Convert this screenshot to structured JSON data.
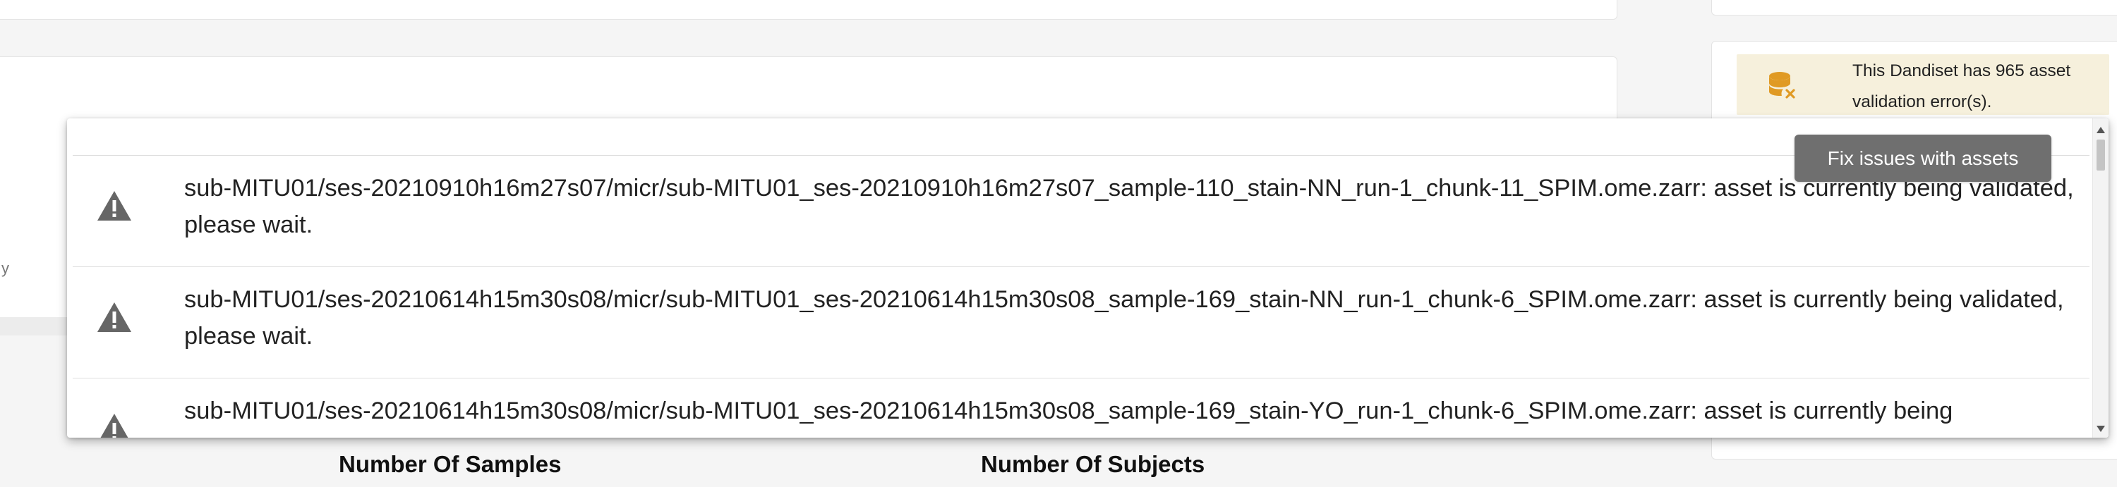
{
  "background": {
    "left_snippet": "y",
    "stats": {
      "samples_label": "Number Of Samples",
      "subjects_label": "Number Of Subjects"
    }
  },
  "validation_alert": {
    "text": "This Dandiset has 965 asset validation error(s).",
    "icon": "database-error-icon",
    "icon_color": "#e09a24",
    "background_color": "#f6f0dc"
  },
  "tooltip": {
    "label": "Fix issues with assets"
  },
  "error_list": {
    "icon": "warning-icon",
    "items": [
      {
        "message": "sub-MITU01/ses-20210910h16m27s07/micr/sub-MITU01_ses-20210910h16m27s07_sample-110_stain-NN_run-1_chunk-11_SPIM.ome.zarr: asset is currently being validated, please wait."
      },
      {
        "message": "sub-MITU01/ses-20210614h15m30s08/micr/sub-MITU01_ses-20210614h15m30s08_sample-169_stain-NN_run-1_chunk-6_SPIM.ome.zarr: asset is currently being validated, please wait."
      },
      {
        "message": "sub-MITU01/ses-20210614h15m30s08/micr/sub-MITU01_ses-20210614h15m30s08_sample-169_stain-YO_run-1_chunk-6_SPIM.ome.zarr: asset is currently being"
      }
    ]
  }
}
